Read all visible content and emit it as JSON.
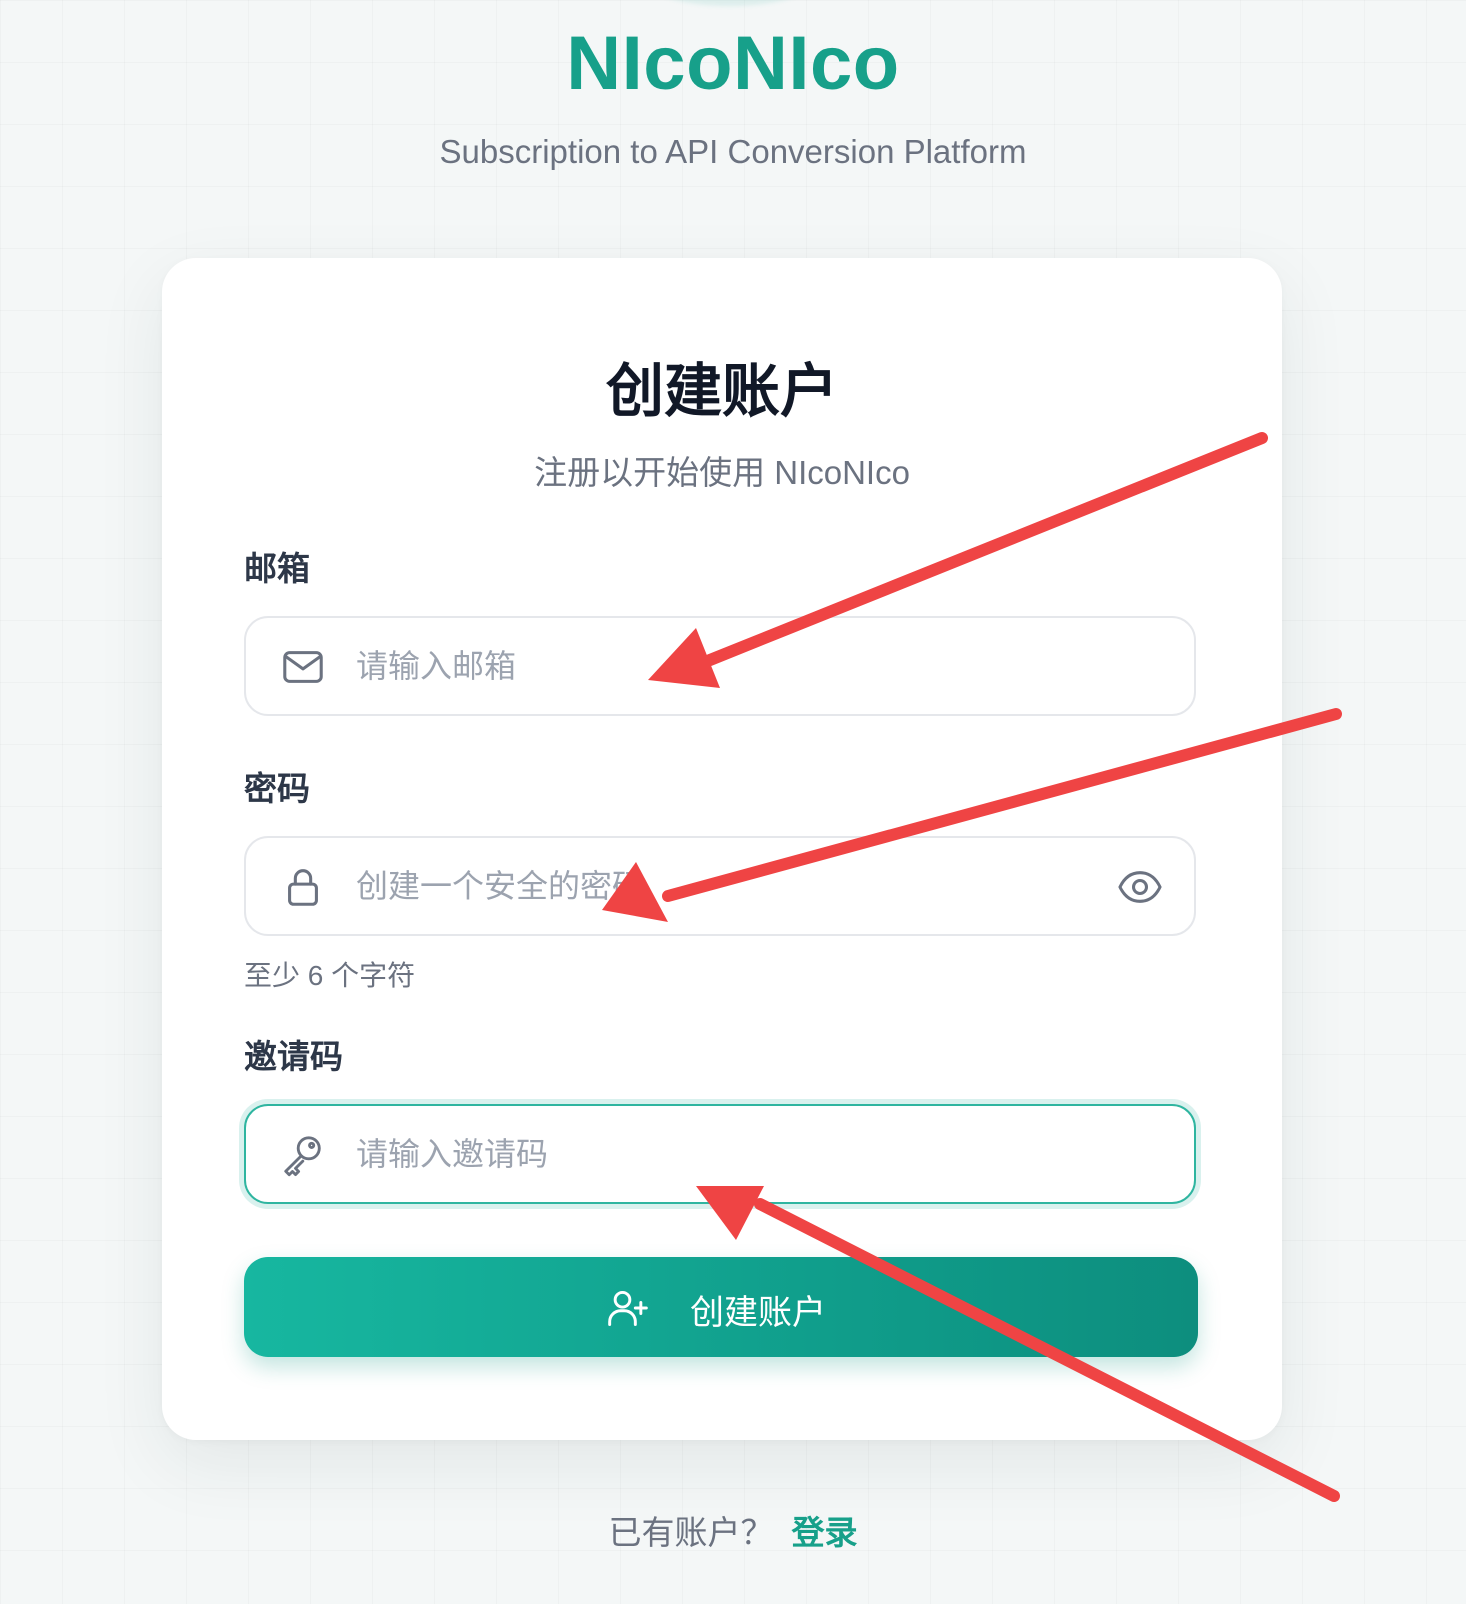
{
  "header": {
    "brand": "NIcoNIco",
    "tagline": "Subscription to API Conversion Platform"
  },
  "card": {
    "title": "创建账户",
    "subtitle": "注册以开始使用 NIcoNIco",
    "email": {
      "label": "邮箱",
      "placeholder": "请输入邮箱",
      "value": "",
      "icon": "mail-icon"
    },
    "password": {
      "label": "密码",
      "placeholder": "创建一个安全的密码",
      "value": "",
      "icon": "lock-icon",
      "toggle_icon": "eye-icon",
      "hint": "至少 6 个字符"
    },
    "invite": {
      "label": "邀请码",
      "placeholder": "请输入邀请码",
      "value": "",
      "icon": "key-icon",
      "focused": true
    },
    "submit": {
      "label": "创建账户",
      "icon": "user-plus-icon"
    }
  },
  "footer": {
    "prompt": "已有账户？",
    "login_label": "登录"
  },
  "colors": {
    "brand": "#17a08a",
    "button_gradient_start": "#17b7a0",
    "button_gradient_end": "#0d8e7e",
    "annotation_arrow": "#ef4444"
  }
}
